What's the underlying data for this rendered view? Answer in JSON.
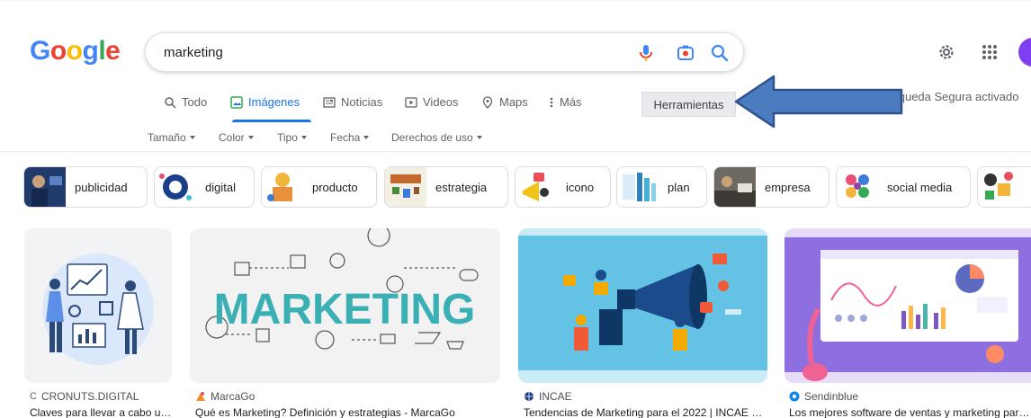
{
  "logo": [
    "G",
    "o",
    "o",
    "g",
    "l",
    "e"
  ],
  "search": {
    "query": "marketing"
  },
  "tabs": [
    {
      "label": "Todo",
      "icon": "search-icon"
    },
    {
      "label": "Imágenes",
      "icon": "image-icon"
    },
    {
      "label": "Noticias",
      "icon": "news-icon"
    },
    {
      "label": "Videos",
      "icon": "play-icon"
    },
    {
      "label": "Maps",
      "icon": "location-pin-icon"
    },
    {
      "label": "Más",
      "icon": "more-vert-icon"
    }
  ],
  "tools_label": "Herramientas",
  "safesearch_label": "úsqueda Segura activado",
  "filters": [
    "Tamaño",
    "Color",
    "Tipo",
    "Fecha",
    "Derechos de uso"
  ],
  "chips": [
    "publicidad",
    "digital",
    "producto",
    "estrategia",
    "icono",
    "plan",
    "empresa",
    "social media"
  ],
  "results": [
    {
      "source": "CRONUTS.DIGITAL",
      "caption": "Claves para llevar a cabo un…"
    },
    {
      "source": "MarcaGo",
      "caption": "Qué es Marketing? Definición y estrategias - MarcaGo",
      "art_text": "MARKETING"
    },
    {
      "source": "INCAE",
      "caption": "Tendencias de Marketing para el 2022 | INCAE B…"
    },
    {
      "source": "Sendinblue",
      "caption": "Los mejores software de ventas y marketing para t…"
    }
  ],
  "colors": {
    "accent_blue": "#1a73e8",
    "arrow_fill": "#4a7cbf",
    "arrow_stroke": "#2f528f"
  }
}
